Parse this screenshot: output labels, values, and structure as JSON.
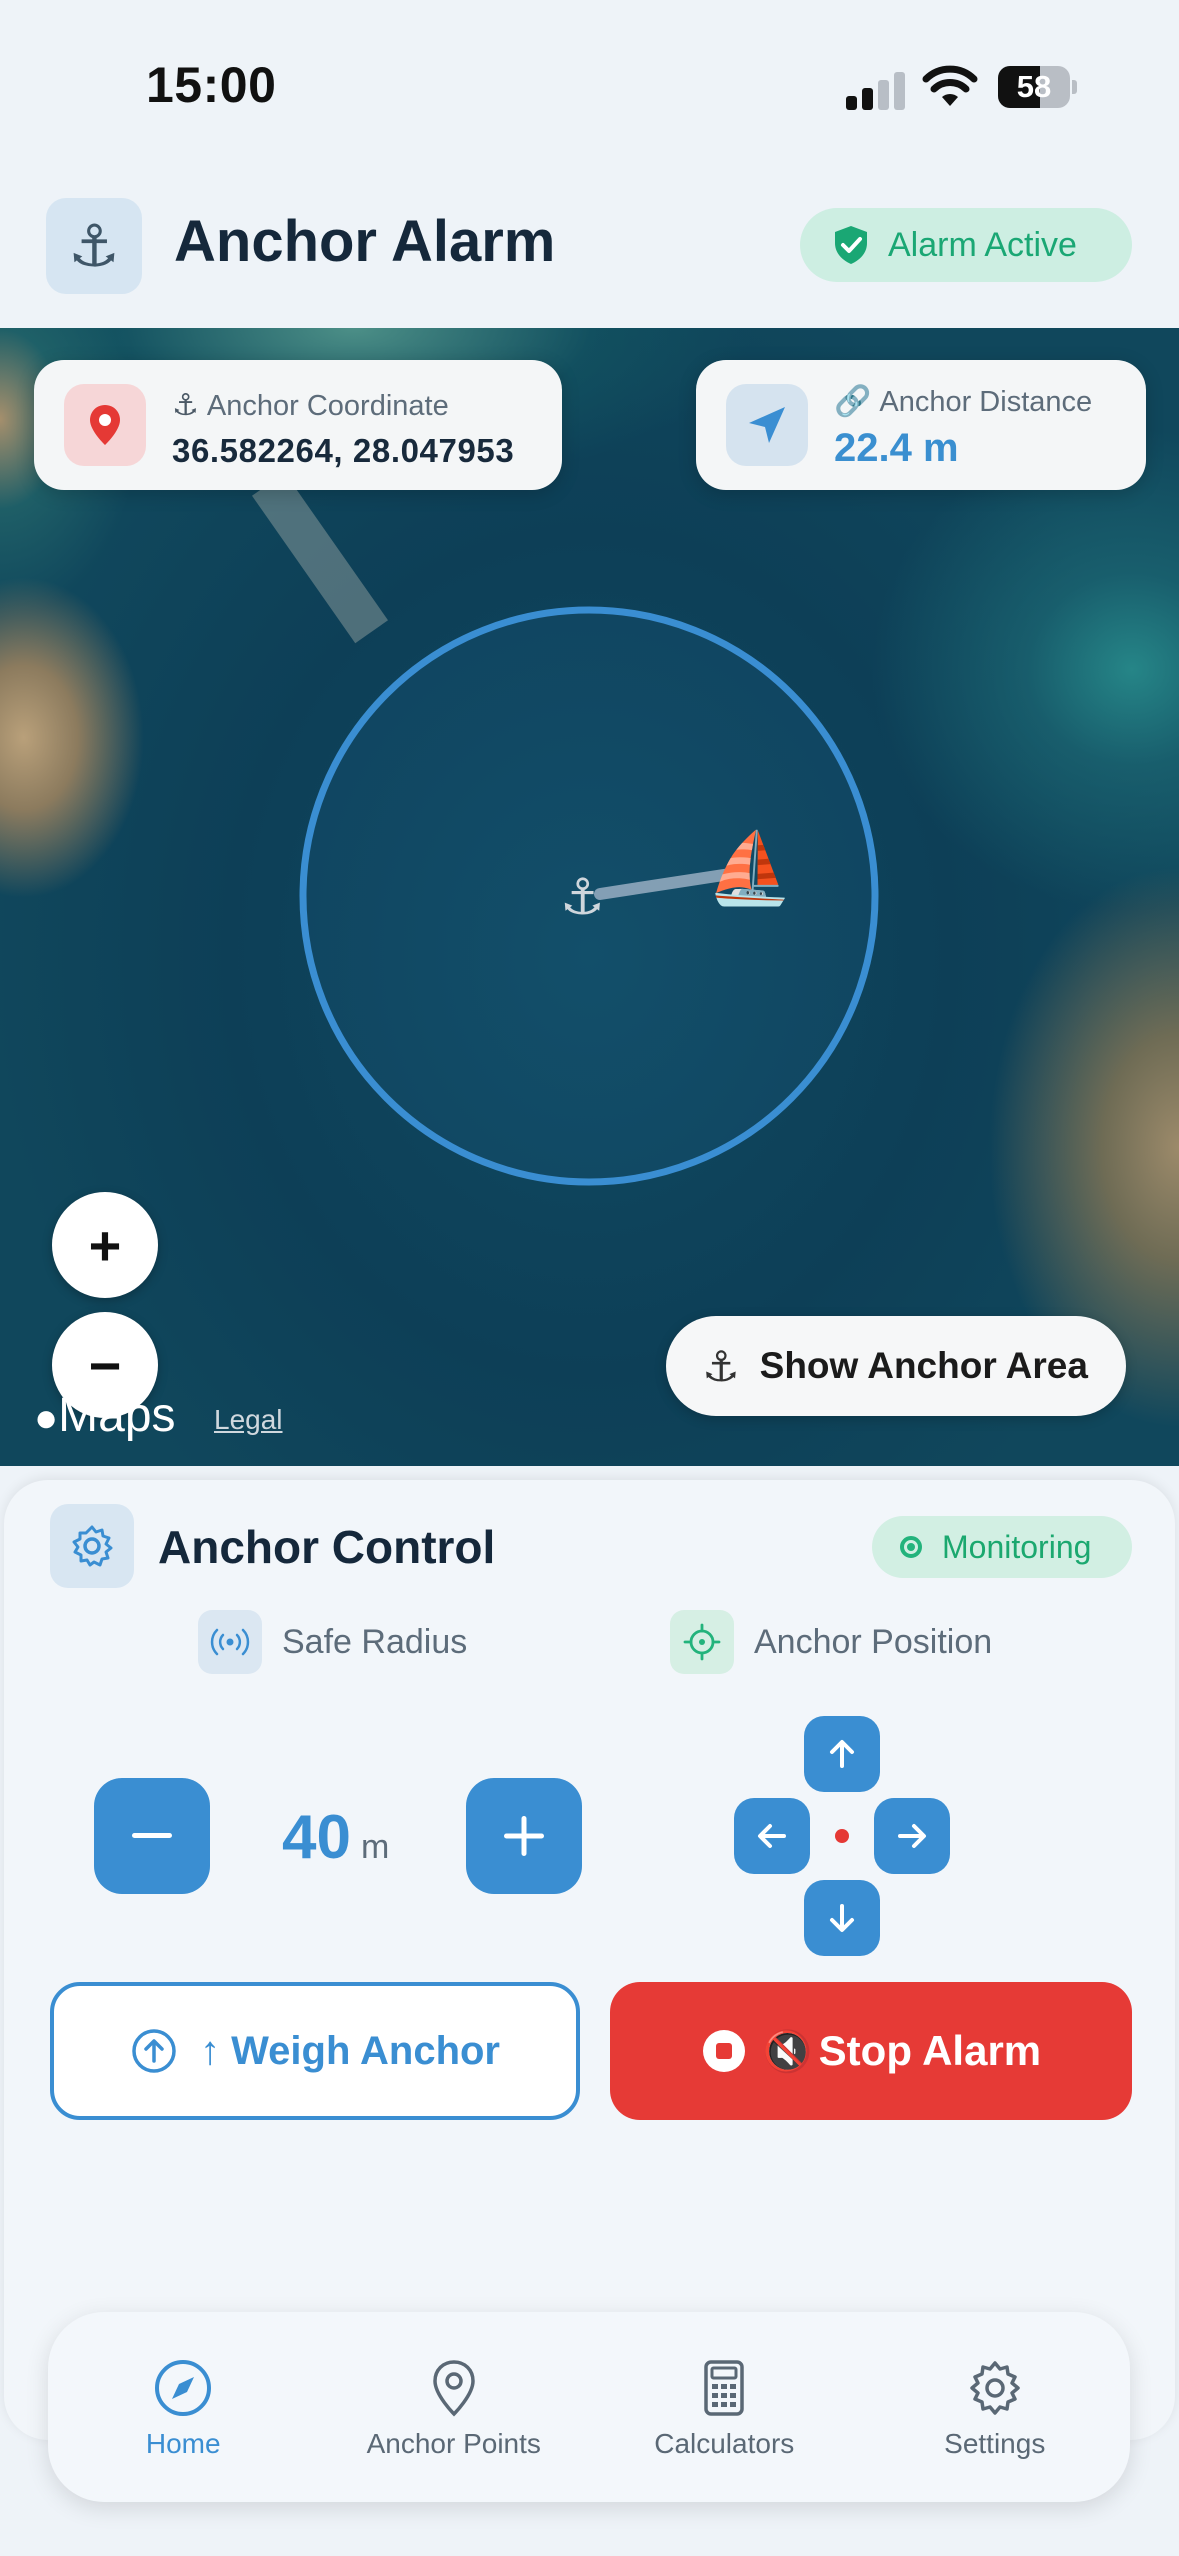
{
  "status_bar": {
    "time": "15:00",
    "battery": "58",
    "battery_level": 0.58
  },
  "header": {
    "title": "Anchor Alarm",
    "app_icon": "anchor-icon",
    "badge": "Alarm Active",
    "badge_color": "#1aa774"
  },
  "map": {
    "coordinate_label": "Anchor Coordinate",
    "coordinate_value": "36.582264, 28.047953",
    "distance_label": "Anchor Distance",
    "distance_value": "22.4 m",
    "zoom_in": "+",
    "zoom_out": "−",
    "maps_brand": "Maps",
    "legal": "Legal",
    "show_area_button": "Show Anchor Area",
    "anchor_marker": "⚓",
    "boat_marker": "⛵",
    "radius_circle_color": "#3a8ed2"
  },
  "control": {
    "title": "Anchor Control",
    "status": "Monitoring",
    "safe_radius_label": "Safe Radius",
    "anchor_position_label": "Anchor Position",
    "radius_value": "40",
    "radius_unit": "m",
    "weigh_button": "↑ Weigh Anchor",
    "stop_button": "Stop Alarm",
    "accent_color": "#3a8ed2",
    "danger_color": "#e63a36"
  },
  "tabs": [
    {
      "label": "Home",
      "icon": "compass-icon",
      "active": true
    },
    {
      "label": "Anchor Points",
      "icon": "map-pin-icon",
      "active": false
    },
    {
      "label": "Calculators",
      "icon": "calculator-icon",
      "active": false
    },
    {
      "label": "Settings",
      "icon": "gear-icon",
      "active": false
    }
  ]
}
